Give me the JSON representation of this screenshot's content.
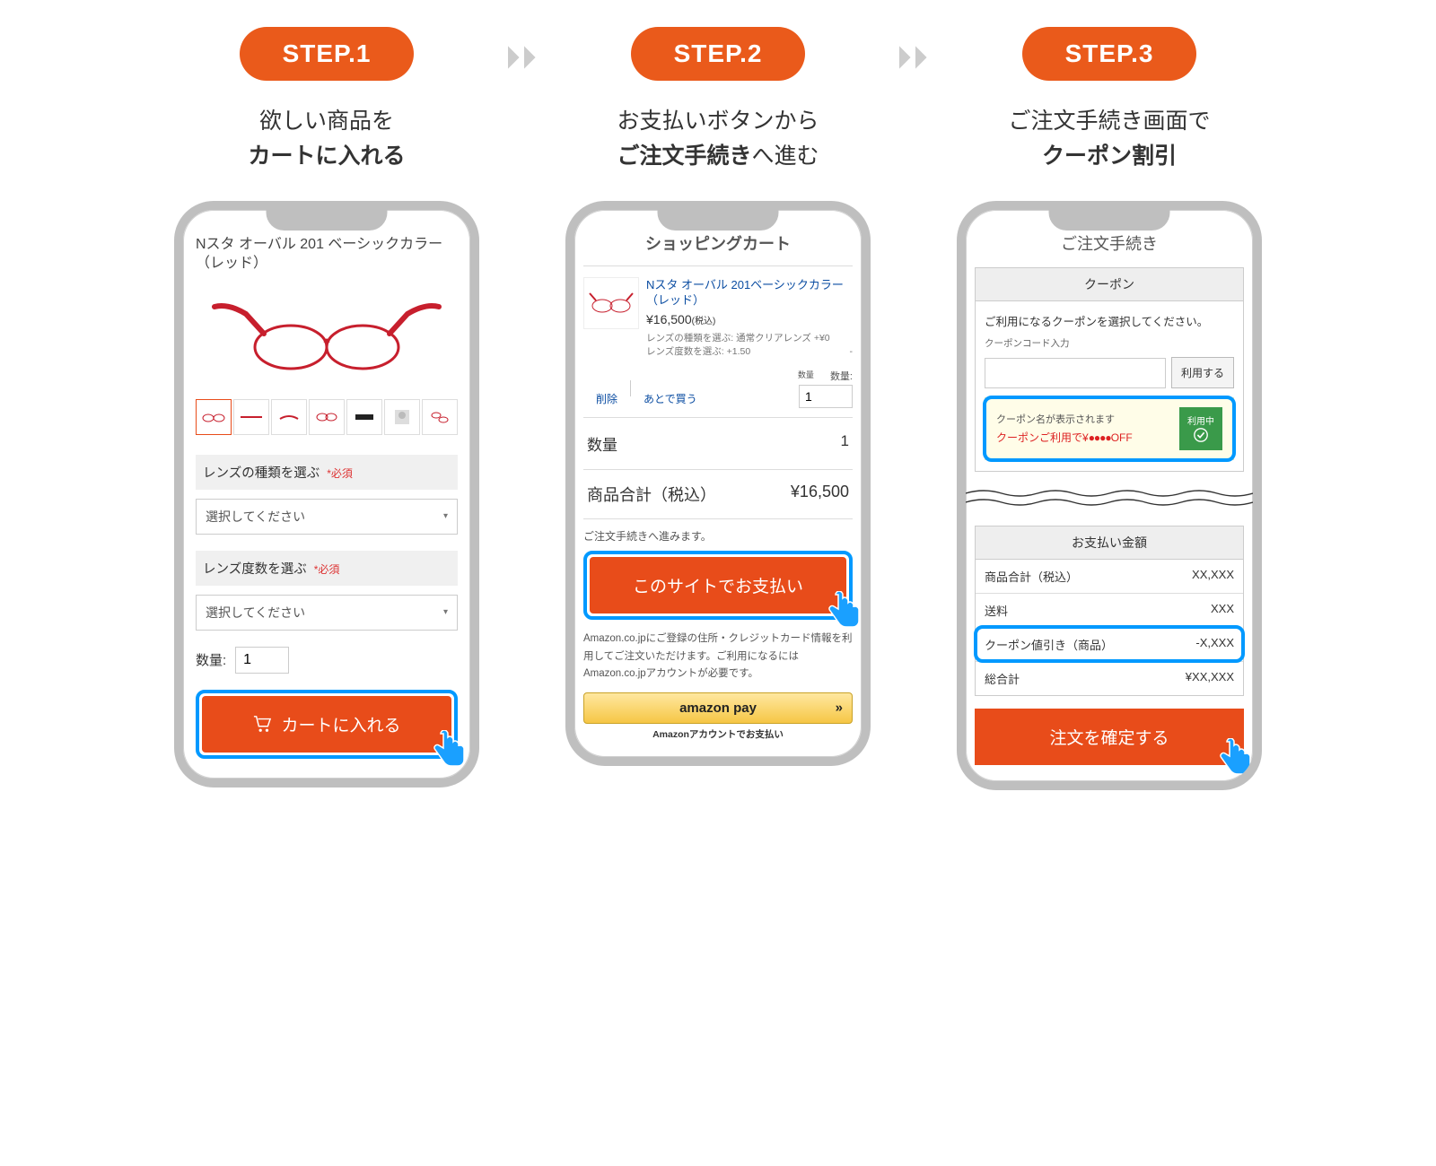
{
  "steps": {
    "s1": {
      "pill": "STEP.1",
      "line1": "欲しい商品を",
      "line2": "カートに入れる"
    },
    "s2": {
      "pill": "STEP.2",
      "line1": "お支払いボタンから",
      "line2a": "ご注文手続き",
      "line2b": "へ進む"
    },
    "s3": {
      "pill": "STEP.3",
      "line1": "ご注文手続き画面で",
      "line2": "クーポン割引"
    }
  },
  "phone1": {
    "product_title": "Nスタ オーバル 201 ベーシックカラー（レッド）",
    "opt1_label": "レンズの種類を選ぶ",
    "opt2_label": "レンズ度数を選ぶ",
    "required": "*必須",
    "select_placeholder": "選択してください",
    "qty_label": "数量:",
    "qty_value": "1",
    "cart_btn": "カートに入れる"
  },
  "phone2": {
    "title": "ショッピングカート",
    "item_name": "Nスタ オーバル 201ベーシックカラー（レッド）",
    "item_price": "¥16,500",
    "tax_note": "(税込)",
    "meta1": "レンズの種類を選ぶ: 通常クリアレンズ +¥0",
    "meta2": "レンズ度数を選ぶ: +1.50",
    "meta2_suffix": "-",
    "del": "削除",
    "later": "あとで買う",
    "qty_small": "数量",
    "qty_label": "数量:",
    "qty_value": "1",
    "sum_qty_l": "数量",
    "sum_qty_v": "1",
    "sum_total_l": "商品合計（税込）",
    "sum_total_v": "¥16,500",
    "note": "ご注文手続きへ進みます。",
    "pay_btn": "このサイトでお支払い",
    "amz_note": "Amazon.co.jpにご登録の住所・クレジットカード情報を利用してご注文いただけます。ご利用になるには Amazon.co.jpアカウントが必要です。",
    "amz_btn": "amazon pay",
    "amz_chev": "»",
    "amz_sub": "Amazonアカウントでお支払い"
  },
  "phone3": {
    "title": "ご注文手続き",
    "coupon_h": "クーポン",
    "coupon_prompt": "ご利用になるクーポンを選択してください。",
    "coupon_input_label": "クーポンコード入力",
    "use_btn": "利用する",
    "applied_t1": "クーポン名が表示されます",
    "applied_t2a": "クーポンご利用で¥",
    "applied_t2b": "●●●●",
    "applied_t2c": "OFF",
    "badge": "利用中",
    "pay_h": "お支払い金額",
    "rows": [
      {
        "l": "商品合計（税込）",
        "v": "XX,XXX"
      },
      {
        "l": "送料",
        "v": "XXX"
      },
      {
        "l": "クーポン値引き（商品）",
        "v": "-X,XXX"
      },
      {
        "l": "総合計",
        "v": "¥XX,XXX"
      }
    ],
    "confirm": "注文を確定する"
  }
}
